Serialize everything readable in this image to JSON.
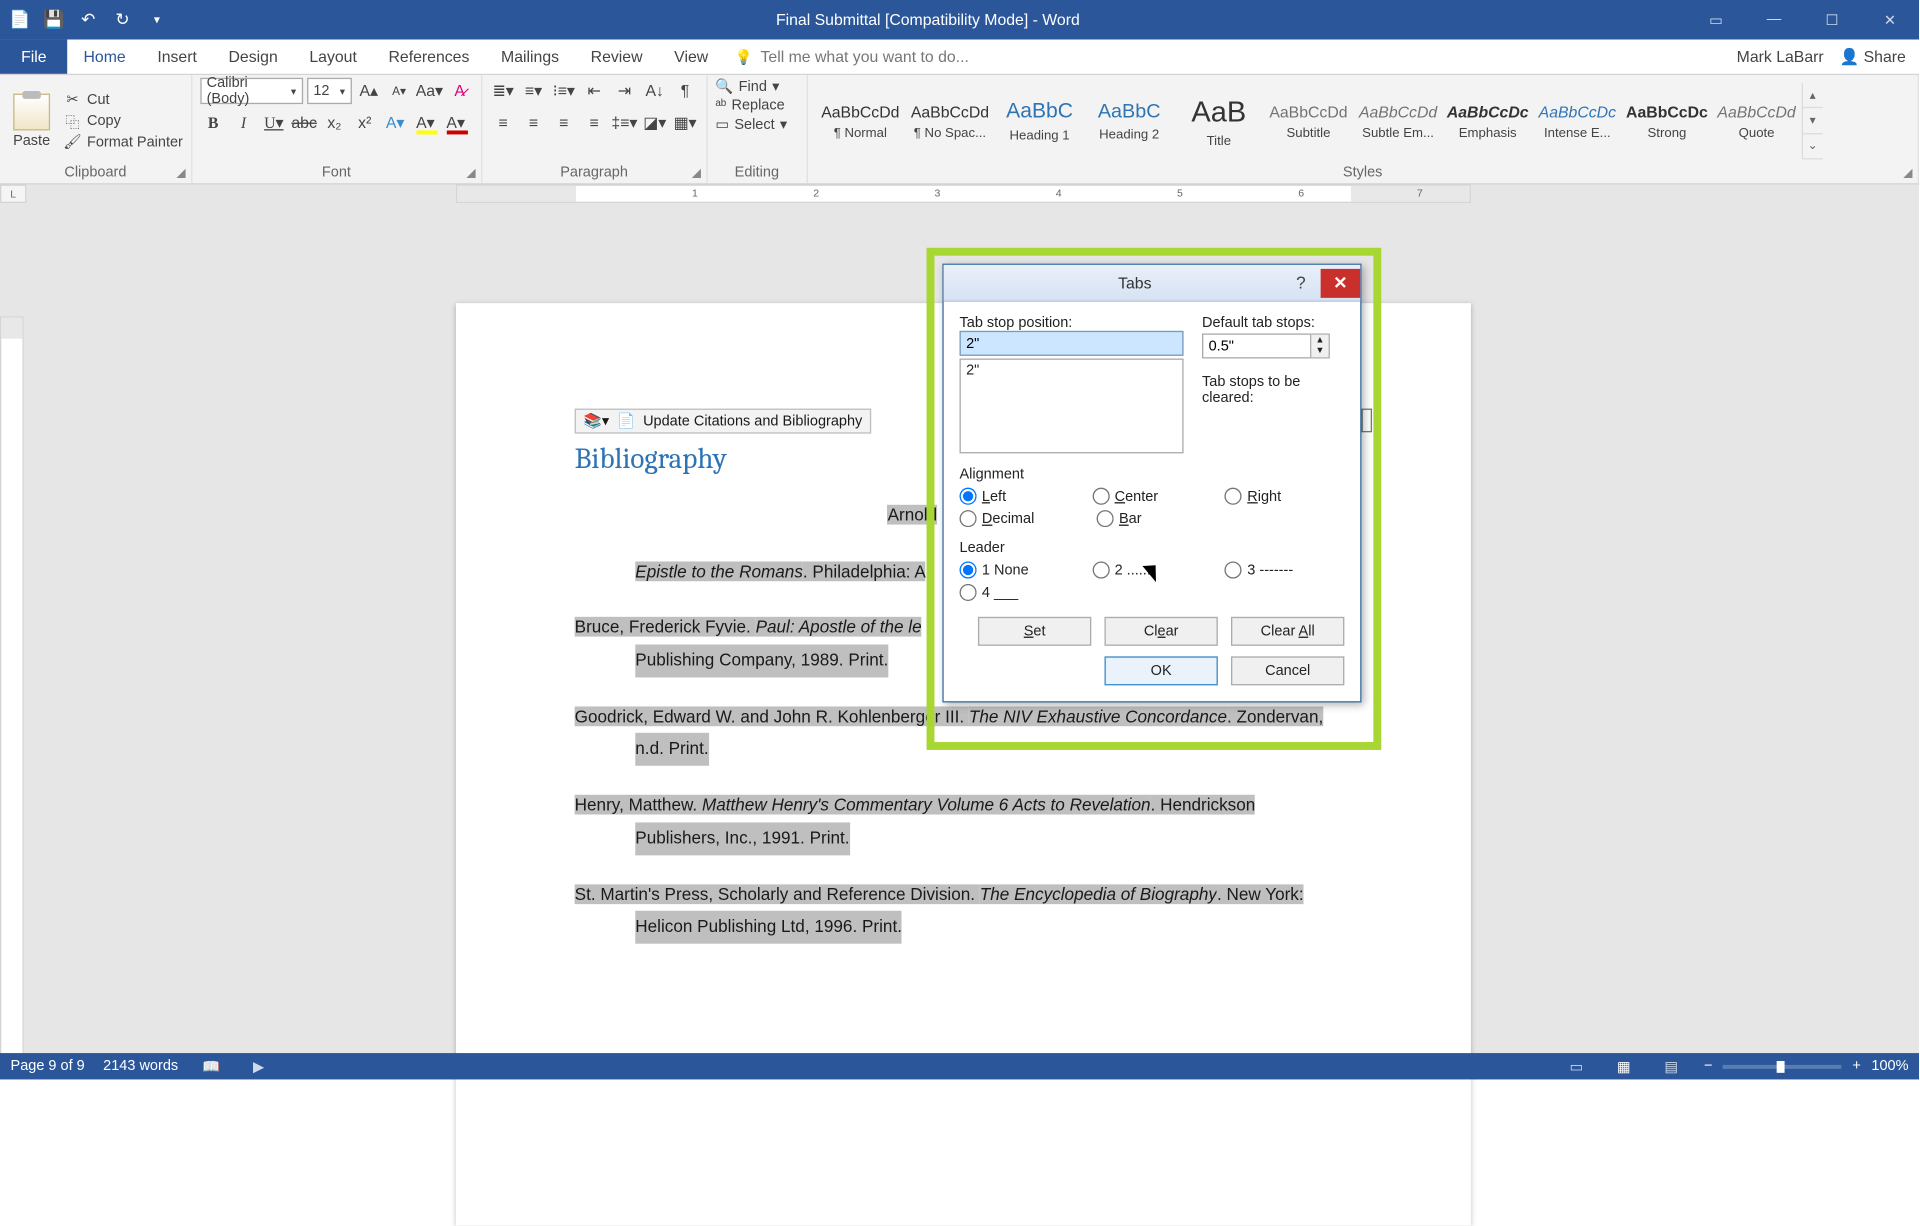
{
  "titlebar": {
    "title": "Final Submittal [Compatibility Mode] - Word"
  },
  "account": {
    "user": "Mark LaBarr",
    "share": "Share"
  },
  "menu": {
    "file": "File",
    "home": "Home",
    "insert": "Insert",
    "design": "Design",
    "layout": "Layout",
    "references": "References",
    "mailings": "Mailings",
    "review": "Review",
    "view": "View",
    "tellme": "Tell me what you want to do..."
  },
  "clipboard": {
    "paste": "Paste",
    "cut": "Cut",
    "copy": "Copy",
    "format_painter": "Format Painter",
    "group": "Clipboard"
  },
  "font": {
    "name": "Calibri (Body)",
    "size": "12",
    "group": "Font"
  },
  "paragraph": {
    "group": "Paragraph"
  },
  "editing": {
    "find": "Find",
    "replace": "Replace",
    "select": "Select",
    "group": "Editing"
  },
  "styles": {
    "group": "Styles",
    "items": [
      {
        "preview": "AaBbCcDd",
        "name": "¶ Normal"
      },
      {
        "preview": "AaBbCcDd",
        "name": "¶ No Spac..."
      },
      {
        "preview": "AaBbC",
        "name": "Heading 1"
      },
      {
        "preview": "AaBbC",
        "name": "Heading 2"
      },
      {
        "preview": "AaB",
        "name": "Title"
      },
      {
        "preview": "AaBbCcDd",
        "name": "Subtitle"
      },
      {
        "preview": "AaBbCcDd",
        "name": "Subtle Em..."
      },
      {
        "preview": "AaBbCcDc",
        "name": "Emphasis"
      },
      {
        "preview": "AaBbCcDc",
        "name": "Intense E..."
      },
      {
        "preview": "AaBbCcDc",
        "name": "Strong"
      },
      {
        "preview": "AaBbCcDd",
        "name": "Quote"
      }
    ]
  },
  "ruler_corner": "L",
  "doc": {
    "update": "Update Citations and Bibliography",
    "heading": "Bibliography",
    "e1a": "Arnold",
    "e2a": "Epistle to the Romans",
    "e2b": ". Philadelphia: A",
    "e3a": "Bruce, Frederick Fyvie. ",
    "e3b": "Paul: Apostle of the  le",
    "e4a": "Publishing Company, 1989. Print.",
    "e5a": "Goodrick, Edward W. and John R. Kohlenberger III. ",
    "e5b": "The NIV Exhaustive Concordance",
    "e5c": ". Zondervan,",
    "e6a": "n.d. Print.",
    "e7a": "Henry, Matthew. ",
    "e7b": "Matthew Henry's Commentary Volume 6 Acts to Revelation",
    "e7c": ". Hendrickson",
    "e8a": "Publishers, Inc., 1991. Print.",
    "e9a": "St. Martin's Press, Scholarly and Reference Division. ",
    "e9b": "The Encyclopedia of Biography",
    "e9c": ". New York:",
    "e10a": "Helicon Publishing Ltd, 1996. Print."
  },
  "status": {
    "page": "Page 9 of 9",
    "words": "2143 words",
    "zoom": "100%"
  },
  "dialog": {
    "title": "Tabs",
    "tab_stop_pos_label": "Tab stop position:",
    "tab_stop_value": "2\"",
    "list_item": "2\"",
    "default_label": "Default tab stops:",
    "default_value": "0.5\"",
    "clear_label": "Tab stops to be cleared:",
    "alignment_label": "Alignment",
    "align": {
      "left": "Left",
      "center": "Center",
      "right": "Right",
      "decimal": "Decimal",
      "bar": "Bar"
    },
    "leader_label": "Leader",
    "leader": {
      "l1": "1 None",
      "l2": "2 .......",
      "l3": "3 -------",
      "l4": "4 ___"
    },
    "btn": {
      "set": "Set",
      "clear": "Clear",
      "clear_all": "Clear All",
      "ok": "OK",
      "cancel": "Cancel"
    }
  }
}
